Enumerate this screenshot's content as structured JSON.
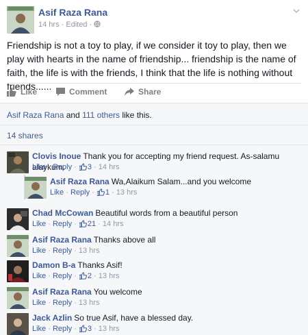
{
  "post": {
    "author": "Asif Raza Rana",
    "time": "14 hrs",
    "edited": "Edited",
    "text": "Friendship is not a toy to play, if we consider it toy to play, then we play with hearts in the name of friendship... friendship is the name of faith, the life is with the friends, I think that the life is nothing without friends......",
    "avatar_caption": "Asif Raza Rana"
  },
  "actions": {
    "like": "Like",
    "comment": "Comment",
    "share": "Share"
  },
  "likes": {
    "name": "Asif Raza Rana",
    "and": " and ",
    "others": "111 others",
    "suffix": " like this."
  },
  "shares": "14 shares",
  "comments": [
    {
      "name": "Clovis Inoue",
      "text": "Thank you for accepting my friend request. As-salamu alaykum.",
      "like": "Like",
      "reply": "Reply",
      "count": "3",
      "time": "14 hrs"
    },
    {
      "name": "Asif Raza Rana",
      "text": "Wa,Alaikum Salam...and you welcome",
      "like": "Like",
      "reply": "Reply",
      "count": "1",
      "time": "13 hrs"
    },
    {
      "name": "Chad McCowan",
      "text": "Beautiful words from a beautiful person",
      "like": "Like",
      "reply": "Reply",
      "count": "21",
      "time": "14 hrs"
    },
    {
      "name": "Asif Raza Rana",
      "text": "Thanks above all",
      "like": "Like",
      "reply": "Reply",
      "time": "13 hrs"
    },
    {
      "name": "Damon B-a",
      "text": "Thanks Asif!",
      "like": "Like",
      "reply": "Reply",
      "count": "2",
      "time": "13 hrs"
    },
    {
      "name": "Asif Raza Rana",
      "text": "You welcome",
      "like": "Like",
      "reply": "Reply",
      "time": "13 hrs"
    },
    {
      "name": "Jack Azlin",
      "text": "So true Asif, have a blessed day.",
      "like": "Like",
      "reply": "Reply",
      "count": "3",
      "time": "13 hrs"
    }
  ],
  "separators": {
    "dot": " · "
  },
  "colors": {
    "link": "#3b5998",
    "meta": "#9197a3",
    "ufi_bg": "#f6f7f9",
    "action": "#7f7f7f"
  }
}
